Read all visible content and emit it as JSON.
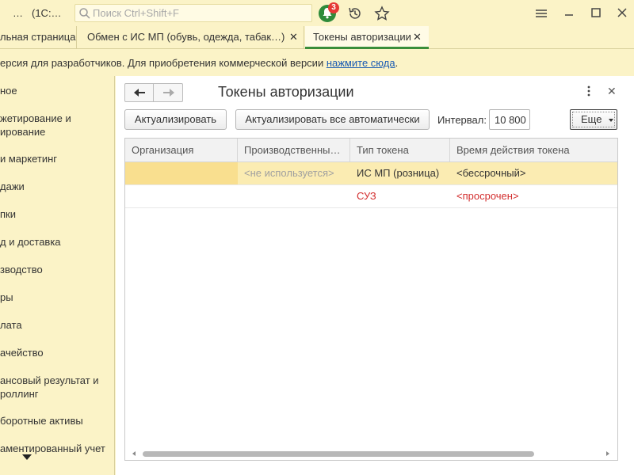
{
  "titlebar": {
    "dots": "…",
    "app": "(1С:…",
    "search_placeholder": "Поиск Ctrl+Shift+F",
    "notifications_count": "3",
    "icons": [
      "search-icon",
      "bell-icon",
      "history-icon",
      "star-icon",
      "menu-icon",
      "minimize-icon",
      "maximize-icon",
      "close-icon"
    ]
  },
  "tabs": [
    {
      "label": "льная страница"
    },
    {
      "label": "Обмен с ИС МП (обувь, одежда, табак…)",
      "close": "✕"
    },
    {
      "label": "Токены авторизации",
      "close": "✕",
      "active": true
    }
  ],
  "infobar": {
    "text": "ерсия для разработчиков. Для приобретения коммерческой версии ",
    "link": "нажмите сюда",
    "suffix": "."
  },
  "sidebar": {
    "items": [
      "ное",
      "жетирование и\nирование",
      " и маркетинг",
      "дажи",
      "пки",
      "д и доставка",
      "зводство",
      "ры",
      "лата",
      "ачейство",
      "ансовый результат и\nроллинг",
      "боротные активы",
      "аментированный учет"
    ]
  },
  "form": {
    "title": "Токены авторизации",
    "kebab": "⋮",
    "close": "✕",
    "buttons": {
      "update": "Актуализировать",
      "update_all": "Актуализировать все автоматически",
      "more": "Еще"
    },
    "interval_label": "Интервал:",
    "interval_value": "10 800"
  },
  "table": {
    "columns": [
      "Организация",
      "Производственны…",
      "Тип токена",
      "Время действия токена"
    ],
    "rows": [
      {
        "org": "",
        "production": "<не используется>",
        "token_type": "ИС МП (розница)",
        "validity": "<бессрочный>"
      },
      {
        "org": "",
        "production": "",
        "token_type": "СУЗ",
        "validity": "<просрочен>"
      }
    ]
  },
  "colors": {
    "background": "#fbf3c7",
    "active_tab_underline": "#3a8e3a",
    "link": "#1a5bb3",
    "selected_row": "#fbecb2",
    "error_text": "#d32f2f"
  }
}
